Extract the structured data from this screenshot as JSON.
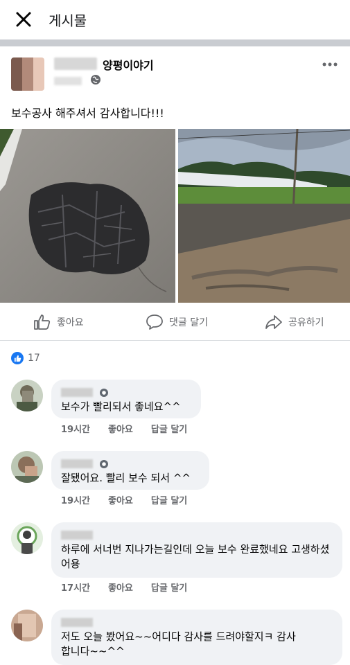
{
  "topbar": {
    "title": "게시물"
  },
  "post": {
    "page_name": "양평이야기",
    "text": "보수공사 해주셔서 감사합니다!!!"
  },
  "actions": {
    "like": "좋아요",
    "comment": "댓글 달기",
    "share": "공유하기"
  },
  "reactions": {
    "count": "17"
  },
  "comments": [
    {
      "text": "보수가 빨리되서 좋네요^^",
      "time": "19시간",
      "like": "좋아요",
      "reply": "답글 달기"
    },
    {
      "text": "잘됐어요. 빨리 보수 되서 ^^",
      "time": "19시간",
      "like": "좋아요",
      "reply": "답글 달기"
    },
    {
      "text": "하루에 서너번 지나가는길인데  오늘  보수 완료했네요 고생하셨어용",
      "time": "17시간",
      "like": "좋아요",
      "reply": "답글 달기"
    },
    {
      "text": "저도 오늘 봤어요~~어디다 감사를 드려야할지ㅋ 감사합니다~~^^"
    }
  ],
  "colors": {
    "accent": "#1877f2",
    "bubble": "#f0f2f5",
    "meta": "#65676b"
  }
}
